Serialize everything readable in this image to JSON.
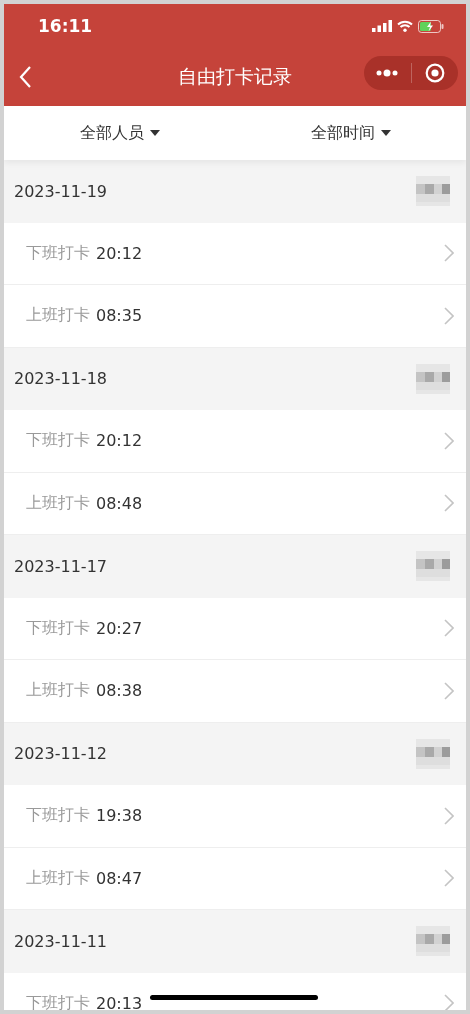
{
  "status_bar": {
    "time": "16:11"
  },
  "nav": {
    "title": "自由打卡记录"
  },
  "filters": [
    {
      "label": "全部人员"
    },
    {
      "label": "全部时间"
    }
  ],
  "groups": [
    {
      "date": "2023-11-19",
      "records": [
        {
          "type": "下班打卡",
          "time": "20:12"
        },
        {
          "type": "上班打卡",
          "time": "08:35"
        }
      ]
    },
    {
      "date": "2023-11-18",
      "records": [
        {
          "type": "下班打卡",
          "time": "20:12"
        },
        {
          "type": "上班打卡",
          "time": "08:48"
        }
      ]
    },
    {
      "date": "2023-11-17",
      "records": [
        {
          "type": "下班打卡",
          "time": "20:27"
        },
        {
          "type": "上班打卡",
          "time": "08:38"
        }
      ]
    },
    {
      "date": "2023-11-12",
      "records": [
        {
          "type": "下班打卡",
          "time": "19:38"
        },
        {
          "type": "上班打卡",
          "time": "08:47"
        }
      ]
    },
    {
      "date": "2023-11-11",
      "records": [
        {
          "type": "下班打卡",
          "time": "20:13"
        }
      ]
    }
  ]
}
